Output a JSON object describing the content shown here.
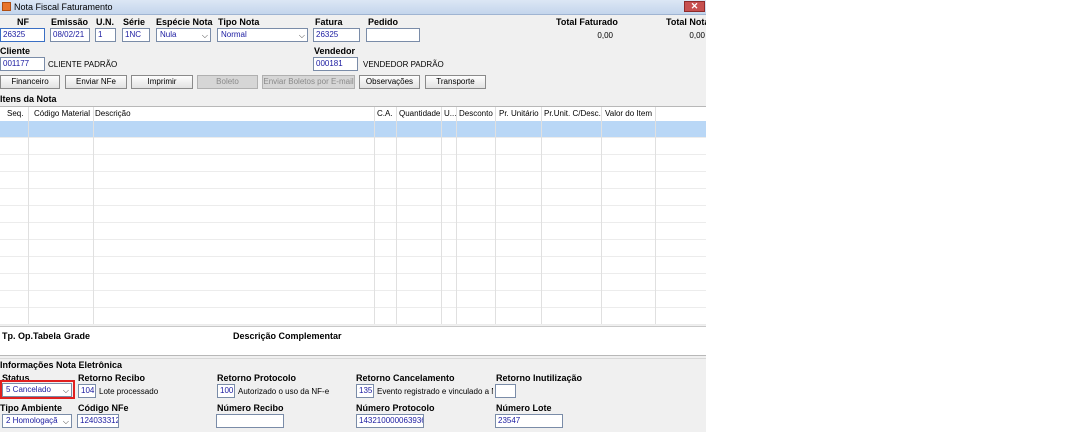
{
  "window": {
    "title": "Nota Fiscal Faturamento",
    "close_label": "✕"
  },
  "header": {
    "nf": {
      "label": "NF",
      "value": "26325"
    },
    "emissao": {
      "label": "Emissão",
      "value": "08/02/21"
    },
    "un": {
      "label": "U.N.",
      "value": "1"
    },
    "serie": {
      "label": "Série",
      "value": "1NC"
    },
    "especie": {
      "label": "Espécie Nota",
      "value": "Nula"
    },
    "tipo_nota": {
      "label": "Tipo Nota",
      "value": "Normal"
    },
    "fatura": {
      "label": "Fatura",
      "value": "26325"
    },
    "pedido": {
      "label": "Pedido",
      "value": ""
    },
    "total_faturado": {
      "label": "Total Faturado",
      "value": "0,00"
    },
    "total_nota": {
      "label": "Total Nota",
      "value": "0,00"
    },
    "cliente": {
      "label": "Cliente",
      "code": "001177",
      "name": "CLIENTE PADRÃO"
    },
    "vendedor": {
      "label": "Vendedor",
      "code": "000181",
      "name": "VENDEDOR PADRÃO"
    }
  },
  "toolbar": {
    "financeiro": "Financeiro",
    "enviar_nfe": "Enviar NFe",
    "imprimir": "Imprimir",
    "boleto": "Boleto",
    "enviar_boletos": "Enviar Boletos por E-mail",
    "observacoes": "Observações",
    "transporte": "Transporte"
  },
  "itens": {
    "section_label": "Itens da Nota",
    "columns": [
      "Seq.",
      "Código Material",
      "Descrição",
      "C.A.",
      "Quantidade",
      "U...",
      "Desconto",
      "Pr. Unitário",
      "Pr.Unit. C/Desc.",
      "Valor do Item"
    ]
  },
  "bottom_grid": {
    "tp_op": "Tp. Op.",
    "tabela": "Tabela",
    "grade": "Grade",
    "descricao_complementar": "Descrição Complementar"
  },
  "nfe": {
    "section_label": "Informações Nota Eletrônica",
    "status": {
      "label": "Status",
      "value": "5 Cancelado"
    },
    "retorno_recibo": {
      "label": "Retorno Recibo",
      "code": "104",
      "text": "Lote processado"
    },
    "retorno_protocolo": {
      "label": "Retorno Protocolo",
      "code": "100",
      "text": "Autorizado o uso da NF-e"
    },
    "retorno_cancelamento": {
      "label": "Retorno Cancelamento",
      "code": "135",
      "text": "Evento registrado e vinculado a N"
    },
    "retorno_inutilizacao": {
      "label": "Retorno Inutilização",
      "value": ""
    },
    "tipo_ambiente": {
      "label": "Tipo Ambiente",
      "value": "2 Homologaçã"
    },
    "codigo_nfe": {
      "label": "Código NFe",
      "value": "124033312"
    },
    "numero_recibo": {
      "label": "Número Recibo",
      "value": ""
    },
    "numero_protocolo": {
      "label": "Número Protocolo",
      "value": "143210000063936"
    },
    "numero_lote": {
      "label": "Número Lote",
      "value": "23547"
    }
  }
}
